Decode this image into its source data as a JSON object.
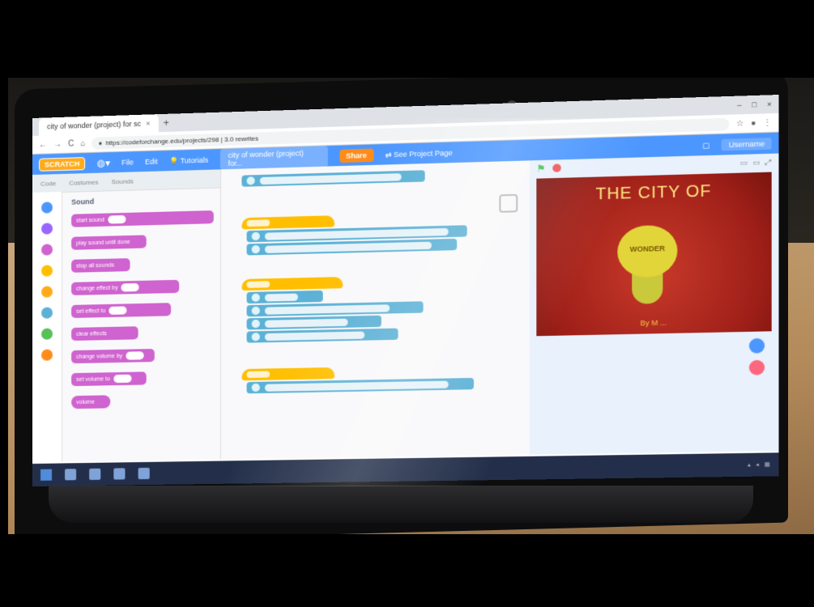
{
  "browser": {
    "tab_title": "city of wonder (project) for sc",
    "url": "https://codeforchange.edu/projects/298 | 3.0 rewrites"
  },
  "menubar": {
    "logo": "SCRATCH",
    "file": "File",
    "edit": "Edit",
    "tutorials": "Tutorials",
    "project_title": "city of wonder (project) for...",
    "share": "Share",
    "see_project_page": "See Project Page",
    "account": "Username"
  },
  "editor_tabs": {
    "code": "Code",
    "costumes": "Costumes",
    "sounds": "Sounds"
  },
  "palette": {
    "title": "Sound",
    "blocks": [
      "start sound",
      "play sound until done",
      "stop all sounds",
      "change effect by",
      "set effect to",
      "clear effects",
      "change volume by",
      "set volume to",
      "volume"
    ]
  },
  "stage": {
    "title": "THE CITY OF",
    "bulb_label": "WONDER",
    "byline": "By M        ..."
  },
  "colors": {
    "menubar": "#4c97ff",
    "events": "#ffbf00",
    "extension": "#5cb1d6",
    "looks": "#9966ff",
    "stage_bg": "#b0271d"
  }
}
